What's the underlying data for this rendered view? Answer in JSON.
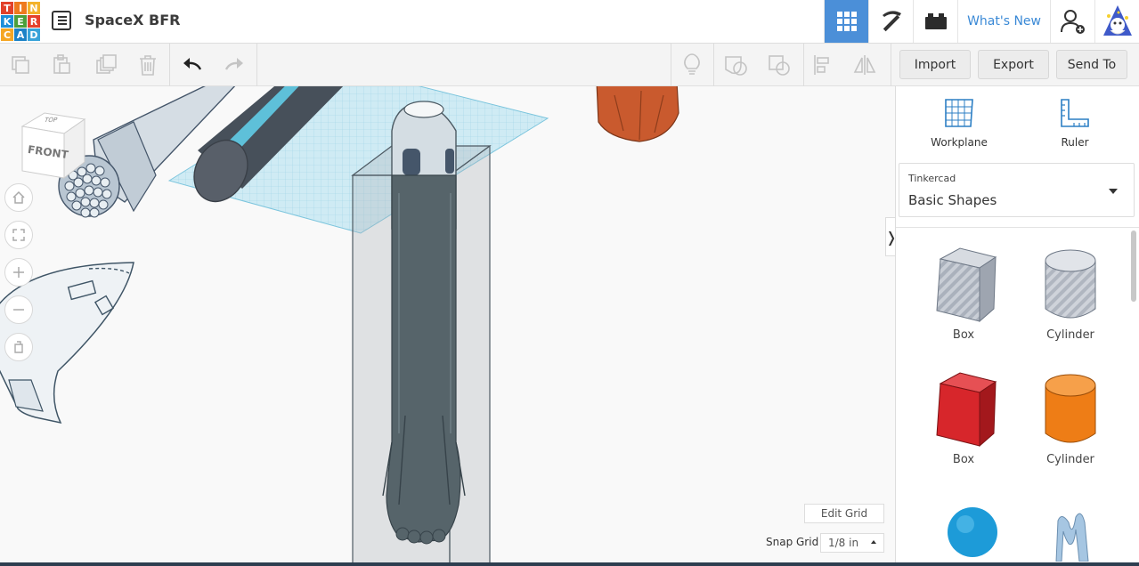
{
  "app": {
    "logo_letters": [
      "T",
      "I",
      "N",
      "K",
      "E",
      "R",
      "C",
      "A",
      "D"
    ],
    "logo_colors": [
      "#e2412a",
      "#ee7a1e",
      "#f3b22b",
      "#1d8ed9",
      "#4b9f3c",
      "#e5412c",
      "#f5a623",
      "#1c82c7",
      "#38a3d9"
    ],
    "design_title": "SpaceX BFR",
    "whats_new": "What's New"
  },
  "toolbar": {
    "import": "Import",
    "export": "Export",
    "send_to": "Send To"
  },
  "viewcube": {
    "top": "TOP",
    "front": "FRONT"
  },
  "grid": {
    "edit_grid": "Edit Grid",
    "snap_label": "Snap Grid",
    "snap_value": "1/8 in"
  },
  "panel": {
    "workplane": "Workplane",
    "ruler": "Ruler",
    "library_small": "Tinkercad",
    "library_main": "Basic Shapes",
    "shapes": [
      {
        "label": "Box",
        "icon": "box-striped-icon"
      },
      {
        "label": "Cylinder",
        "icon": "cylinder-striped-icon"
      },
      {
        "label": "Box",
        "icon": "box-red-icon"
      },
      {
        "label": "Cylinder",
        "icon": "cylinder-orange-icon"
      },
      {
        "label": "",
        "icon": "sphere-icon"
      },
      {
        "label": "",
        "icon": "scribble-icon"
      }
    ]
  },
  "colors": {
    "accent": "#4b8fd8",
    "box_red": "#d7262b",
    "cylinder_orange": "#ee7d16",
    "sphere_blue": "#1d9bd8",
    "rocket_gray": "#56646a",
    "engine_orange": "#c55a2e"
  }
}
